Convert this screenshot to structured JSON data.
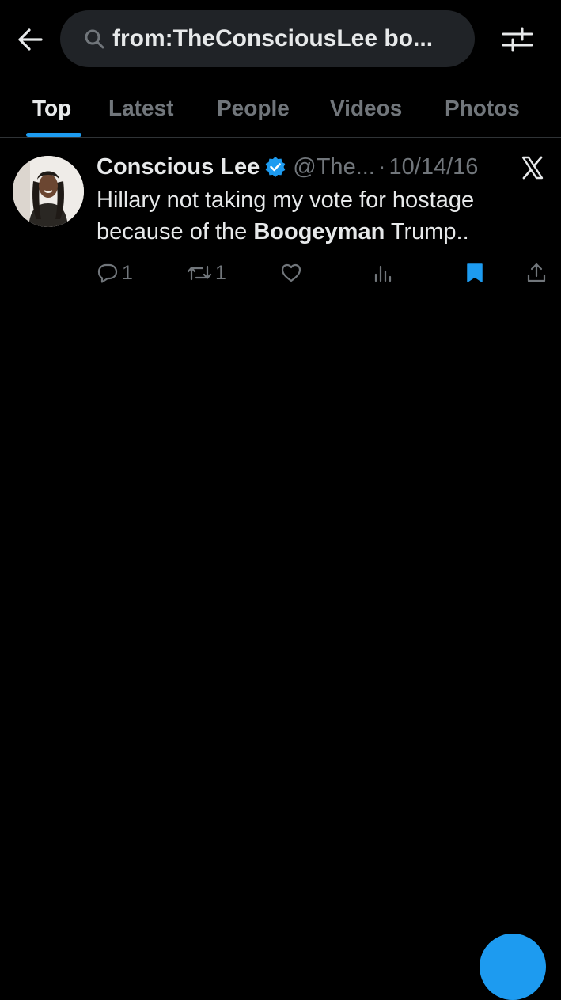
{
  "search": {
    "query": "from:TheConsciousLee bo..."
  },
  "tabs": [
    {
      "label": "Top",
      "active": true
    },
    {
      "label": "Latest",
      "active": false
    },
    {
      "label": "People",
      "active": false
    },
    {
      "label": "Videos",
      "active": false
    },
    {
      "label": "Photos",
      "active": false
    }
  ],
  "tweet": {
    "display_name": "Conscious Lee",
    "verified": true,
    "handle": "@The...",
    "separator": "·",
    "date": "10/14/16",
    "text_before": "Hillary not taking my vote for hostage because of the ",
    "text_bold": "Boogeyman",
    "text_after": " Trump..",
    "replies": "1",
    "retweets": "1",
    "likes": "",
    "bookmarked": true
  },
  "icons": {
    "back": "arrow-left-icon",
    "search": "search-icon",
    "filter": "sliders-icon",
    "verified": "verified-badge-icon",
    "platform": "x-logo-icon",
    "reply": "reply-icon",
    "retweet": "retweet-icon",
    "like": "heart-icon",
    "views": "views-icon",
    "bookmark": "bookmark-icon",
    "share": "share-icon",
    "compose": "compose-fab"
  },
  "colors": {
    "background": "#000000",
    "text_primary": "#e7e9ea",
    "text_secondary": "#71767b",
    "accent": "#1d9bf0",
    "search_bg": "#202327"
  }
}
